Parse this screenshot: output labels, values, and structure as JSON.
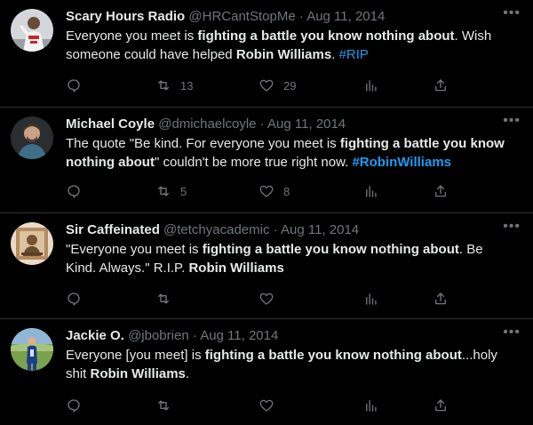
{
  "tweets": [
    {
      "name": "Scary Hours Radio",
      "handle": "@HRCantStopMe",
      "sep": "·",
      "date": "Aug 11, 2014",
      "text": [
        {
          "t": "Everyone you meet is "
        },
        {
          "t": "fighting a battle you know nothing about",
          "b": true
        },
        {
          "t": ". Wish someone could have helped "
        },
        {
          "t": "Robin Williams",
          "b": true
        },
        {
          "t": ". "
        },
        {
          "t": "#RIP",
          "link": true
        }
      ],
      "retweets": "13",
      "likes": "29",
      "avatar_bg": "#cfd2d6"
    },
    {
      "name": "Michael Coyle",
      "handle": "@dmichaelcoyle",
      "sep": "·",
      "date": "Aug 11, 2014",
      "text": [
        {
          "t": "The quote \"Be kind. For everyone you meet is "
        },
        {
          "t": "fighting a battle you know nothing about",
          "b": true
        },
        {
          "t": "\" couldn't be more true right now. "
        },
        {
          "t": "#RobinWilliams",
          "link": true,
          "b": true
        }
      ],
      "retweets": "5",
      "likes": "8",
      "avatar_bg": "#3a3d40"
    },
    {
      "name": "Sir Caffeinated",
      "handle": "@tetchyacademic",
      "sep": "·",
      "date": "Aug 11, 2014",
      "text": [
        {
          "t": "\"Everyone you meet is "
        },
        {
          "t": "fighting a battle you know nothing about",
          "b": true
        },
        {
          "t": ".  Be Kind.  Always.\"  R.I.P. "
        },
        {
          "t": "Robin Williams",
          "b": true
        }
      ],
      "retweets": "",
      "likes": "",
      "avatar_bg": "#c9a27a"
    },
    {
      "name": "Jackie O.",
      "handle": "@jbobrien",
      "sep": "·",
      "date": "Aug 11, 2014",
      "text": [
        {
          "t": "Everyone [you meet] is "
        },
        {
          "t": "fighting a battle you know nothing about",
          "b": true
        },
        {
          "t": "...holy shit "
        },
        {
          "t": "Robin Williams",
          "b": true
        },
        {
          "t": "."
        }
      ],
      "retweets": "",
      "likes": "",
      "avatar_bg": "#5b8a3a"
    }
  ],
  "icons": {
    "reply": "reply-icon",
    "retweet": "retweet-icon",
    "like": "heart-icon",
    "views": "views-icon",
    "share": "share-icon",
    "more": "more-icon"
  },
  "colors": {
    "background": "#000000",
    "text": "#e7e9ea",
    "muted": "#71767b",
    "link": "#1d9bf0",
    "divider": "#2f3336"
  }
}
